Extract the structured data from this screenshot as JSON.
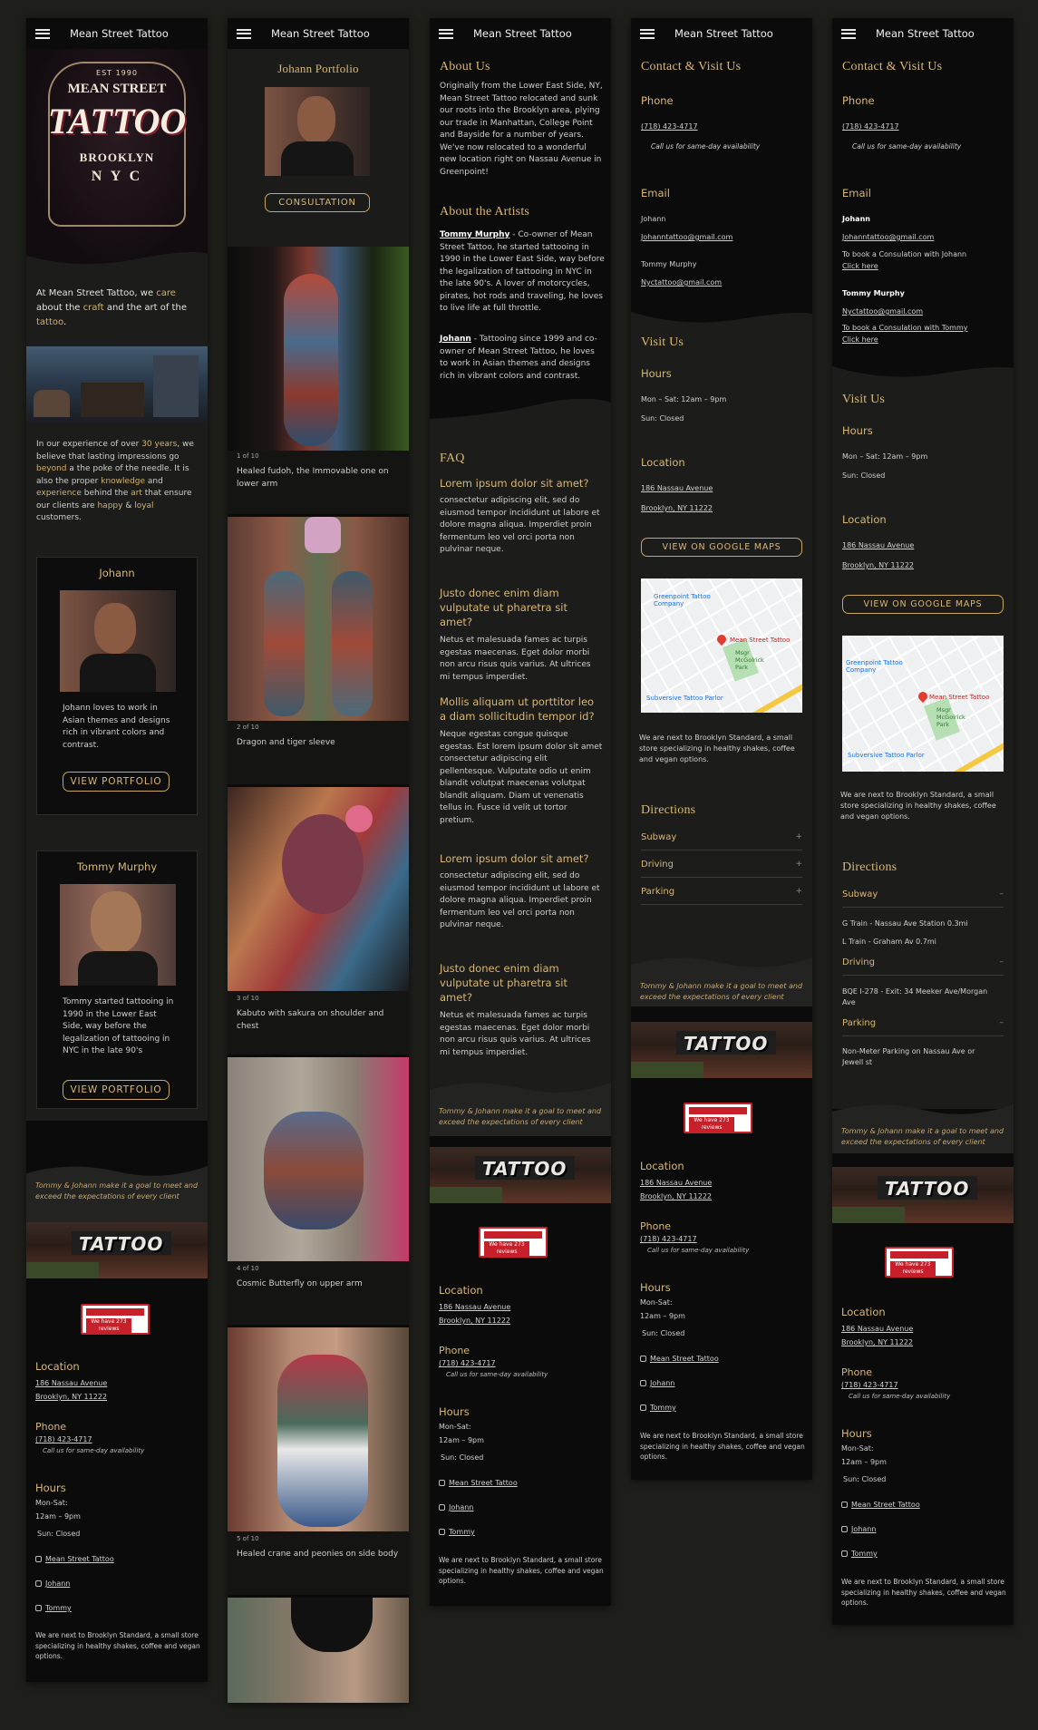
{
  "brand": "Mean Street Tattoo",
  "logo": {
    "est": "EST 1990",
    "line1": "MEAN STREET",
    "line2": "TATTOO",
    "line3": "BROOKLYN",
    "line4": "N Y C"
  },
  "home": {
    "intro": [
      "At Mean Street Tattoo, we ",
      "care",
      " about the ",
      "craft",
      " and the art of the ",
      "tattoo",
      "."
    ],
    "experience": [
      "In our experience of over ",
      "30 years",
      ", we believe that lasting impressions go ",
      "beyond",
      " a the poke of the needle. It is also the proper ",
      "knowledge",
      " and ",
      "experience",
      " behind the ",
      "art",
      " that ensure our clients are ",
      "happy",
      " & ",
      "loyal",
      " customers."
    ],
    "artist1": {
      "name": "Johann",
      "bio": "Johann loves to work in Asian themes and designs rich in vibrant colors and contrast.",
      "button": "VIEW PORTFOLIO"
    },
    "artist2": {
      "name": "Tommy Murphy",
      "bio": "Tommy started tattooing in 1990 in the Lower East Side, way before the legalization of tattooing in NYC in the late 90's",
      "button": "VIEW PORTFOLIO"
    }
  },
  "footer": {
    "quote": "Tommy & Johann make it a goal to meet and exceed the expectations of every client",
    "sign": "TATTOO",
    "yelp": "We have 273 reviews",
    "location_title": "Location",
    "address1": "186 Nassau Avenue",
    "address2": "Brooklyn, NY 11222",
    "phone_title": "Phone",
    "phone": "(718) 423-4717",
    "phone_note": "Call us for same-day availability",
    "hours_title": "Hours",
    "hours1": "Mon-Sat:",
    "hours2": "12am – 9pm",
    "hours3": "Sun: Closed",
    "ig1": "Mean Street Tattoo",
    "ig2": "Johann",
    "ig3": "Tommy",
    "note": "We are next to Brooklyn Standard, a small store specializing in healthy shakes, coffee and vegan options."
  },
  "portfolio": {
    "title": "Johann Portfolio",
    "button": "CONSULTATION",
    "items": [
      {
        "count": "1 of 10",
        "caption": "Healed fudoh, the Immovable one on lower arm"
      },
      {
        "count": "2 of 10",
        "caption": "Dragon and tiger sleeve"
      },
      {
        "count": "3 of 10",
        "caption": "Kabuto with sakura on shoulder and chest"
      },
      {
        "count": "4 of 10",
        "caption": "Cosmic Butterfly on upper arm"
      },
      {
        "count": "5 of 10",
        "caption": "Healed crane and peonies on side body"
      }
    ]
  },
  "about": {
    "title": "About Us",
    "text": "Originally from the Lower East Side, NY, Mean Street Tattoo relocated and sunk our roots into the Brooklyn area, plying our trade in Manhattan, College Point and Bayside for a number of years. We've now relocated to a wonderful new location right on Nassau Avenue in Greenpoint!",
    "artists_title": "About the Artists",
    "tommy_name": "Tommy Murphy",
    "tommy_text": " - Co-owner of Mean Street Tattoo, he started tattooing in 1990 in the Lower East Side, way before the legalization of tattooing in NYC in the late 90's. A lover of motorcycles, pirates, hot rods and traveling, he loves to live life at full throttle.",
    "johann_name": "Johann",
    "johann_text": " - Tattooing since 1999 and co-owner of Mean Street Tattoo, he loves to work in Asian themes and designs rich in vibrant colors and contrast.",
    "faq_title": "FAQ",
    "faq": [
      {
        "q": "Lorem ipsum dolor sit amet?",
        "a": "consectetur adipiscing elit, sed do eiusmod tempor incididunt ut labore et dolore magna aliqua. Imperdiet proin fermentum leo vel orci porta non pulvinar neque."
      },
      {
        "q": "Justo donec enim diam vulputate ut pharetra sit amet?",
        "a": "Netus et malesuada fames ac turpis egestas maecenas. Eget dolor morbi non arcu risus quis varius. At ultrices mi tempus imperdiet."
      },
      {
        "q": "Mollis aliquam ut porttitor leo a diam sollicitudin tempor id?",
        "a": "Neque egestas congue quisque egestas. Est lorem ipsum dolor sit amet consectetur adipiscing elit pellentesque. Vulputate odio ut enim blandit volutpat maecenas volutpat blandit aliquam. Diam ut venenatis tellus in. Fusce id velit ut tortor pretium."
      },
      {
        "q": "Lorem ipsum dolor sit amet?",
        "a": "consectetur adipiscing elit, sed do eiusmod tempor incididunt ut labore et dolore magna aliqua. Imperdiet proin fermentum leo vel orci porta non pulvinar neque."
      },
      {
        "q": "Justo donec enim diam vulputate ut pharetra sit amet?",
        "a": "Netus et malesuada fames ac turpis egestas maecenas. Eget dolor morbi non arcu risus quis varius. At ultrices mi tempus imperdiet."
      }
    ]
  },
  "contact": {
    "title": "Contact & Visit Us",
    "phone_title": "Phone",
    "phone": "(718) 423-4717",
    "phone_note": "Call us for same-day availability",
    "email_title": "Email",
    "johann": "Johann",
    "johann_email": "Johanntattoo@gmail.com",
    "tommy": "Tommy Murphy",
    "tommy_email": "Nyctattoo@gmail.com",
    "book_johann": "To book a Consulation with Johann",
    "book_tommy": "To book a Consulation with Tommy",
    "click_here": "Click here",
    "visit_title": "Visit Us",
    "hours_title": "Hours",
    "hours_week": "Mon – Sat: 12am – 9pm",
    "hours_sun": "Sun: Closed",
    "location_title": "Location",
    "address1": "186 Nassau Avenue",
    "address2": "Brooklyn, NY 11222",
    "maps_button": "VIEW ON GOOGLE MAPS",
    "map": {
      "place1": "Greenpoint Tattoo Company",
      "place2": "Mean Street Tattoo",
      "place3": "Msgr McGolrick Park",
      "place4": "Subversive Tattoo Parlor"
    },
    "near": "We are next to Brooklyn Standard, a small store specializing in healthy shakes, coffee and vegan options.",
    "directions_title": "Directions",
    "subway": "Subway",
    "driving": "Driving",
    "parking": "Parking",
    "subway1": "G Train - Nassau Ave Station 0.3mi",
    "subway2": "L Train - Graham Av 0.7mi",
    "driving1": "BQE I-278 - Exit: 34 Meeker Ave/Morgan Ave",
    "parking1": "Non-Meter Parking on Nassau Ave or Jewell st"
  }
}
